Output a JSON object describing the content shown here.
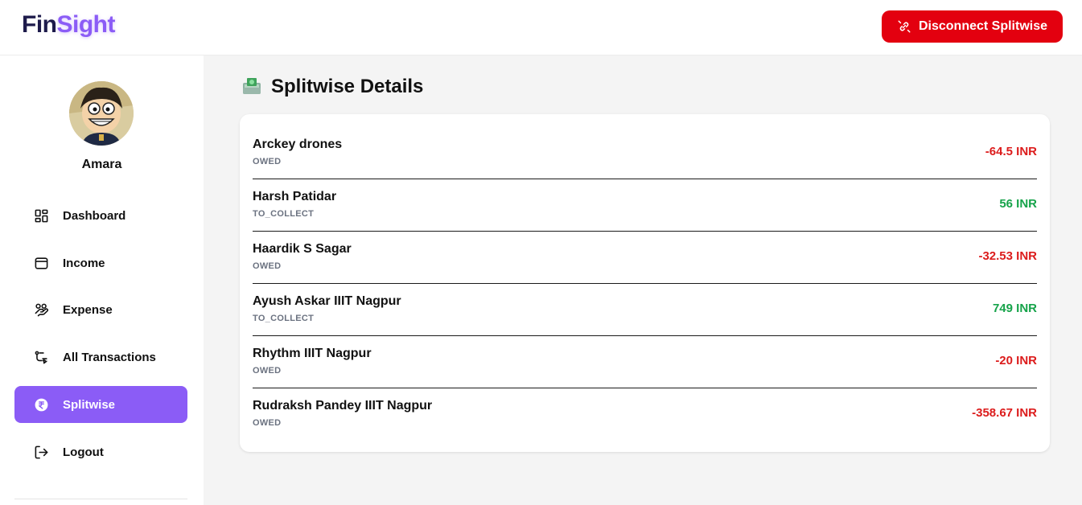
{
  "header": {
    "logo_part1": "Fin",
    "logo_part2": "Sight",
    "disconnect_label": "Disconnect Splitwise",
    "disconnect_color": "#e3000f"
  },
  "sidebar": {
    "username": "Amara",
    "accent_color": "#8b5cf6",
    "items": [
      {
        "label": "Dashboard",
        "icon": "dashboard-grid-icon"
      },
      {
        "label": "Income",
        "icon": "wallet-icon"
      },
      {
        "label": "Expense",
        "icon": "hand-coins-icon"
      },
      {
        "label": "All Transactions",
        "icon": "transactions-icon"
      },
      {
        "label": "Splitwise",
        "icon": "rupee-circle-icon",
        "active": true
      },
      {
        "label": "Logout",
        "icon": "logout-icon"
      }
    ]
  },
  "main": {
    "title": "Splitwise Details",
    "entries": [
      {
        "name": "Arckey drones",
        "status": "OWED",
        "amount": "-64.5 INR"
      },
      {
        "name": "Harsh Patidar",
        "status": "TO_COLLECT",
        "amount": "56 INR"
      },
      {
        "name": "Haardik S Sagar",
        "status": "OWED",
        "amount": "-32.53 INR"
      },
      {
        "name": "Ayush Askar IIIT Nagpur",
        "status": "TO_COLLECT",
        "amount": "749 INR"
      },
      {
        "name": "Rhythm IIIT Nagpur",
        "status": "OWED",
        "amount": "-20 INR"
      },
      {
        "name": "Rudraksh Pandey IIIT Nagpur",
        "status": "OWED",
        "amount": "-358.67 INR"
      }
    ],
    "colors": {
      "owed": "#dc1c1c",
      "collect": "#16a34a"
    }
  }
}
